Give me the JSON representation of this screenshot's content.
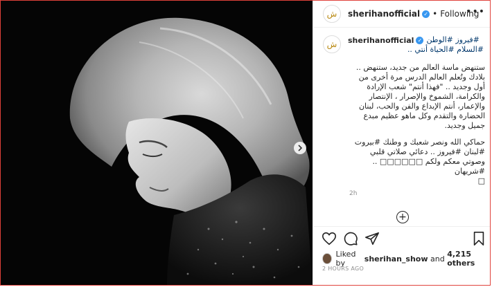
{
  "header": {
    "username": "sherihanofficial",
    "separator": "•",
    "follow_state": "Following",
    "more_icon": "more-horizontal-icon"
  },
  "caption": {
    "username": "sherihanofficial",
    "line1_hashtags": "#فيروز #الوطن",
    "line2_hashtags": "#السلام #الحياة أنتي ..",
    "paragraph1": [
      "ستنهض ماسة العالم من جديد، ستنهض ..",
      "بلادك وتُعلم العالم الدرس مرة أخرى من",
      "أول وجديد .. \"فهذا أنتم\" شعب الإرادة",
      "والكرامة، الشموخ والإصرار ، الإنتصار",
      "والإعمار، أنتم الإبداع والفن والحب، لبنان",
      "الحضارة والتقدم وكل ماهو عظيم مبدع",
      "جميل وجديد."
    ],
    "paragraph2": [
      "حماكي الله ونصر شعبك و وطنك #بيروت",
      "#لبنان #فيروز .. دعائي صلاتي قلبي",
      "وصوتي معكم ولكم □□□□□□ .. #شريهان",
      "□"
    ],
    "time": "2h"
  },
  "likes": {
    "prefix": "Liked by",
    "user": "sherihan_show",
    "conjunction": "and",
    "count": "4,215 others"
  },
  "date": "2 HOURS AGO",
  "icons": [
    "heart-icon",
    "comment-icon",
    "share-icon",
    "bookmark-icon",
    "add-comment-icon",
    "carousel-next-icon",
    "verified-badge-icon"
  ],
  "colors": {
    "accent_blue": "#3897f0",
    "hashtag": "#00376b",
    "text": "#262626",
    "muted": "#8e8e8e",
    "frame_border": "#e0413a"
  }
}
